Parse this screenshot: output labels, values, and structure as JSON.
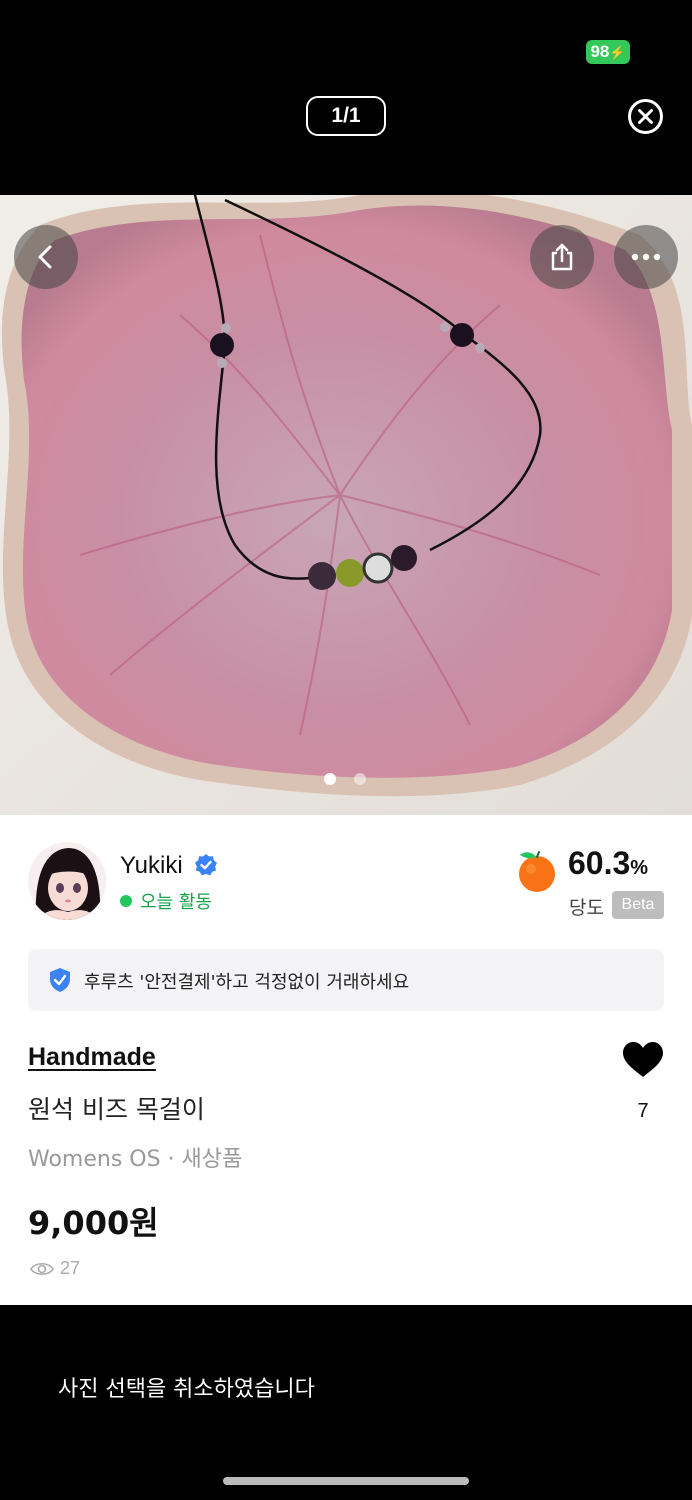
{
  "status_bar": {
    "battery": "98"
  },
  "viewer": {
    "counter": "1/1"
  },
  "photo": {
    "dots_total": 2,
    "active_dot": 1
  },
  "seller": {
    "name": "Yukiki",
    "activity": "오늘 활동",
    "score": "60.3",
    "score_unit": "%",
    "score_label": "당도",
    "beta_badge": "Beta"
  },
  "safe_payment_banner": "후루츠 '안전결제'하고 걱정없이 거래하세요",
  "product": {
    "brand": "Handmade",
    "title": "원석 비즈 목걸이",
    "meta": "Womens OS · 새상품",
    "price": "9,000원",
    "views": "27",
    "likes": "7"
  },
  "toast": "사진 선택을 취소하였습니다",
  "colors": {
    "battery_green": "#34c759",
    "online_green": "#16a34a",
    "shield_blue": "#3b82f6",
    "plate_pink": "#c9899e"
  }
}
